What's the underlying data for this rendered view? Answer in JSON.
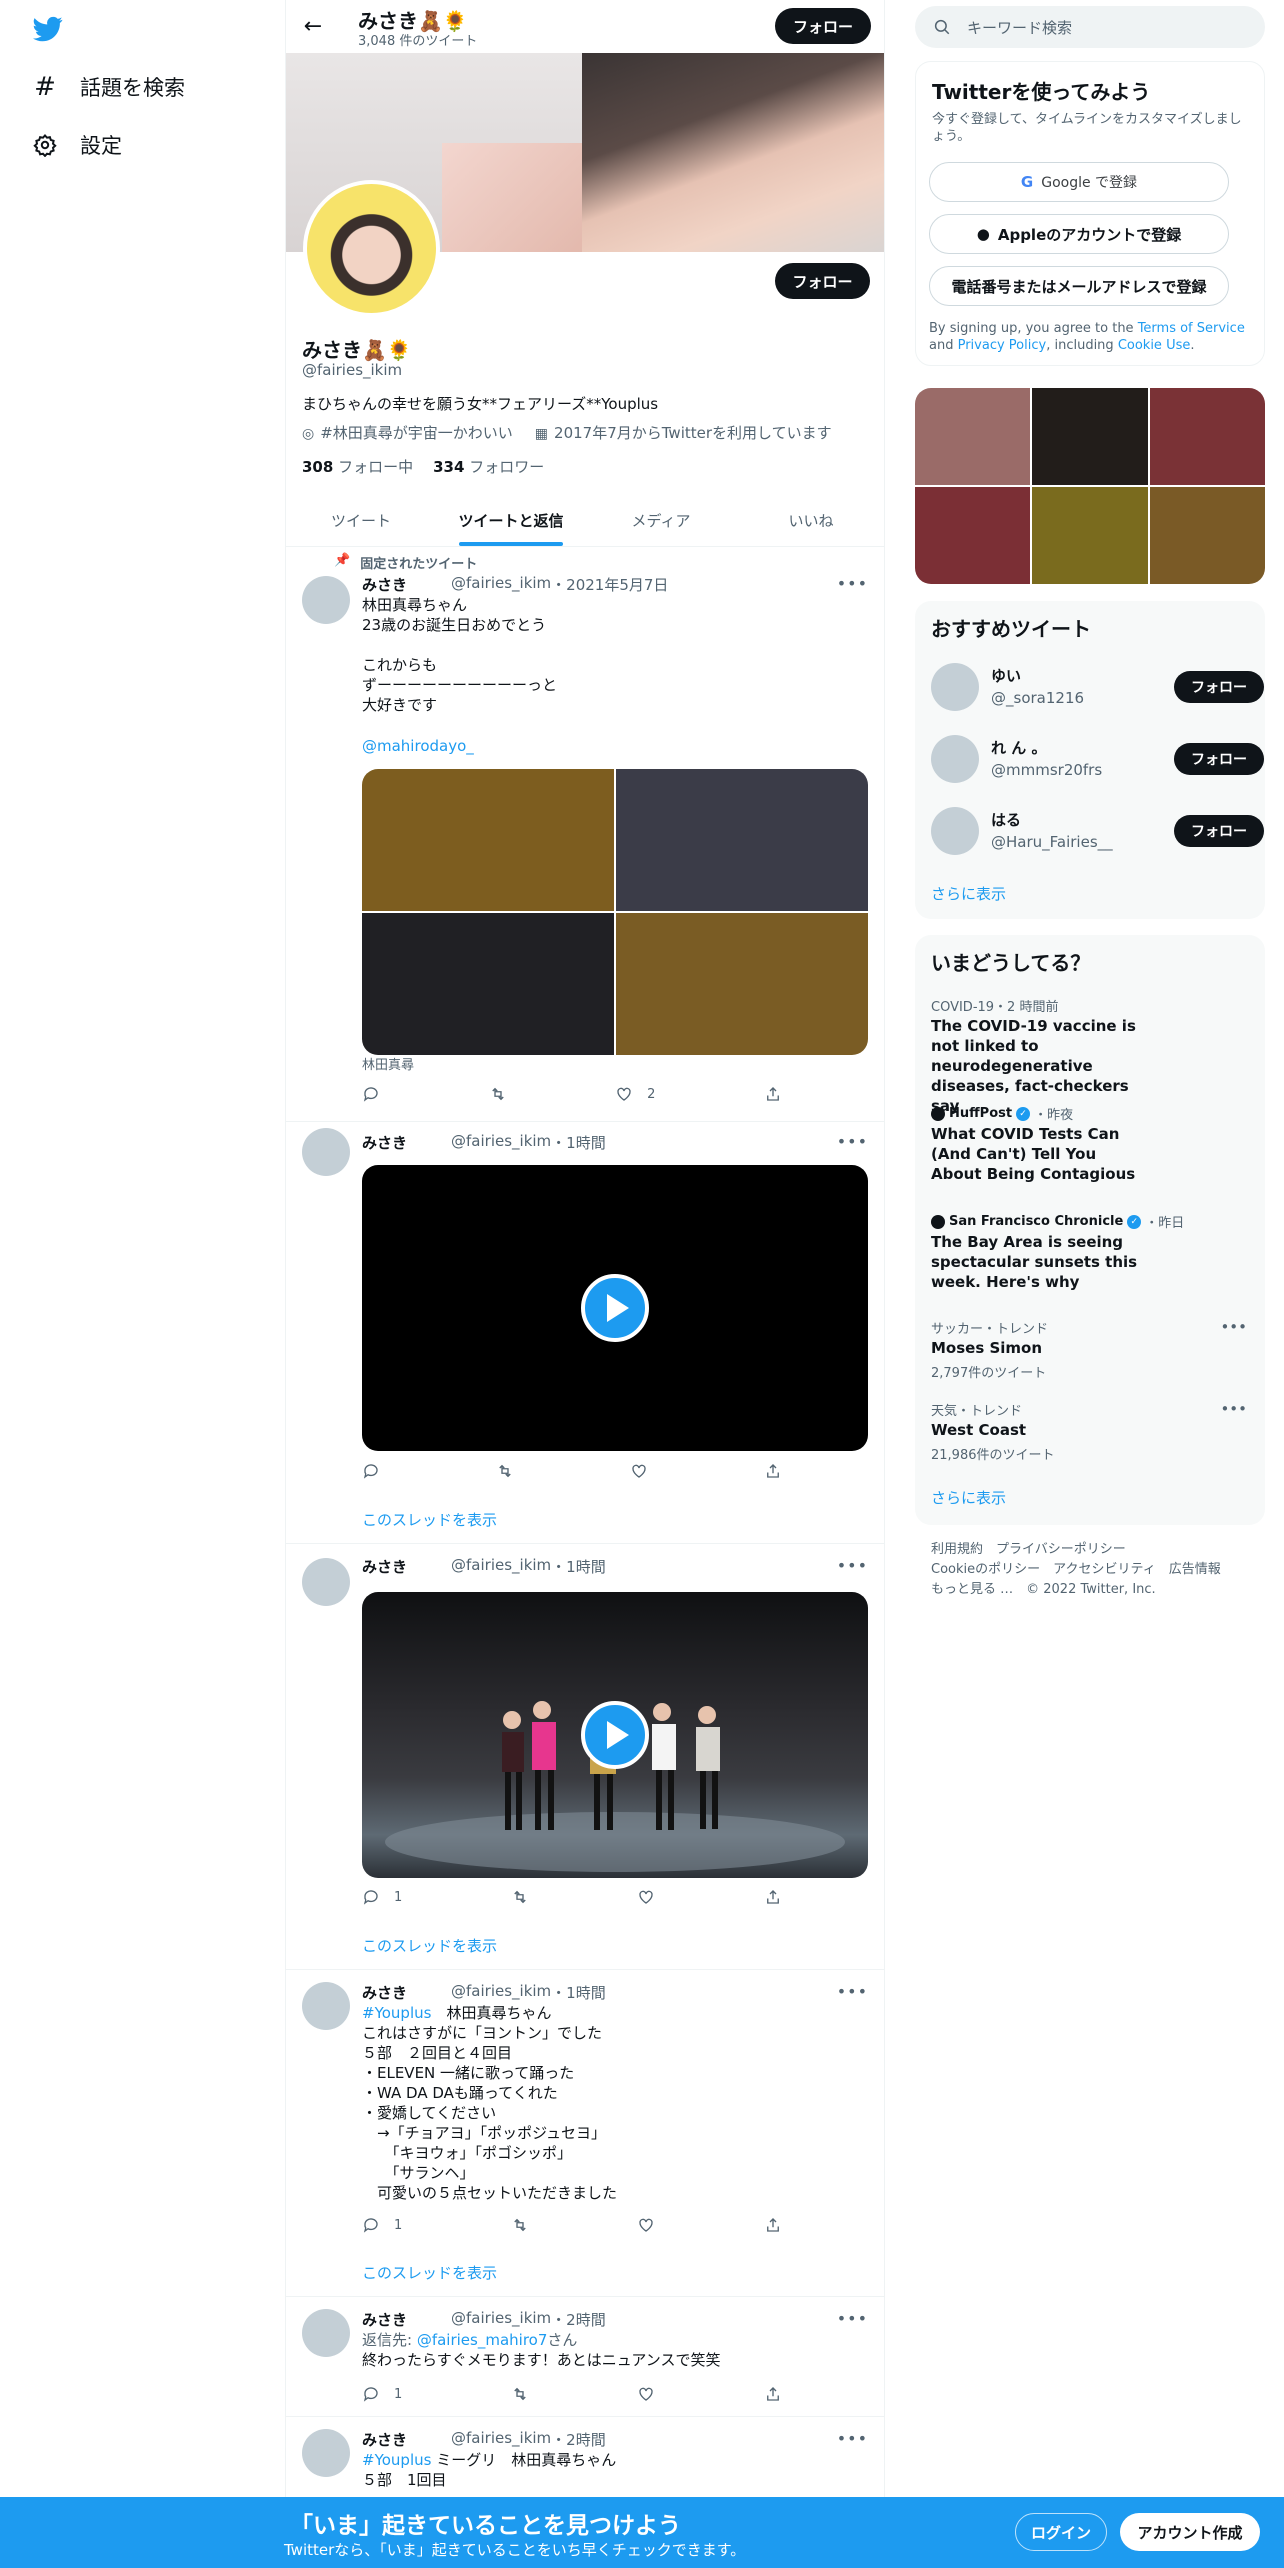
{
  "nav": {
    "explore_label": "話題を検索",
    "settings_label": "設定"
  },
  "header": {
    "name": "みさき🧸🌻",
    "tweet_count": "3,048 件のツイート",
    "follow_label": "フォロー"
  },
  "profile": {
    "name": "みさき🧸🌻",
    "handle": "@fairies_ikim",
    "bio": "まひちゃんの幸せを願う女**フェアリーズ**Youplus",
    "location": "#林田真尋が宇宙一かわいい",
    "joined": "2017年7月からTwitterを利用しています",
    "following_count": "308",
    "following_label": "フォロー中",
    "followers_count": "334",
    "followers_label": "フォロワー",
    "follow_label": "フォロー"
  },
  "tabs": [
    "ツイート",
    "ツイートと返信",
    "メディア",
    "いいね"
  ],
  "pinned_label": "固定されたツイート",
  "tweets": [
    {
      "name": "みさき",
      "handle": "@fairies_ikim",
      "time": "・2021年5月7日",
      "text": "林田真尋ちゃん\n23歳のお誕生日おめでとう\n\nこれからも\nずーーーーーーーーーーっと\n大好きです",
      "mention": "@mahirodayo_",
      "caption": "林田真尋",
      "likes": "2",
      "colors": [
        "#7d5d1f",
        "#3b3c48",
        "#202024",
        "#7a5c24"
      ]
    },
    {
      "name": "みさき",
      "handle": "@fairies_ikim",
      "time": "・1時間",
      "thread": "このスレッドを表示"
    },
    {
      "name": "みさき",
      "handle": "@fairies_ikim",
      "time": "・1時間",
      "replies": "1",
      "thread": "このスレッドを表示"
    },
    {
      "name": "みさき",
      "handle": "@fairies_ikim",
      "time": "・1時間",
      "hashtag": "#Youplus",
      "line1": "　林田真尋ちゃん",
      "text": "これはさすがに「ヨントン」でした\n５部　２回目と４回目\n・ELEVEN 一緒に歌って踊った\n・WA DA DAも踊ってくれた\n・愛嬌してください\n　→「チョアヨ」「ポッポジュセヨ」\n　　「キヨウォ」「ポゴシッポ」\n　　「サランヘ」\n　可愛いの５点セットいただきました",
      "replies": "1",
      "thread": "このスレッドを表示"
    },
    {
      "name": "みさき",
      "handle": "@fairies_ikim",
      "time": "・2時間",
      "reply_prefix": "返信先: ",
      "reply_to": "@fairies_mahiro7",
      "reply_suffix": "さん",
      "text": "終わったらすぐメモります！あとはニュアンスで笑笑",
      "replies": "1"
    },
    {
      "name": "みさき",
      "handle": "@fairies_ikim",
      "time": "・2時間",
      "hashtag": "#Youplus",
      "line1": " ミーグリ　林田真尋ちゃん",
      "text": "５部　1回目"
    }
  ],
  "right": {
    "search_placeholder": "キーワード検索",
    "signup": {
      "title": "Twitterを使ってみよう",
      "subtitle": "今すぐ登録して、タイムラインをカスタマイズしましょう。",
      "google": "Google で登録",
      "apple": "Appleのアカウントで登録",
      "phone": "電話番号またはメールアドレスで登録",
      "legal_1": "By signing up, you agree to the ",
      "terms": "Terms of Service",
      "legal_2": " and ",
      "privacy": "Privacy Policy",
      "legal_3": ", including ",
      "cookie": "Cookie Use",
      "legal_4": "."
    },
    "photo_colors": [
      "#9a6b68",
      "#221d1a",
      "#7a3236",
      "#7b2f35",
      "#7a6b1e",
      "#7a5a26"
    ],
    "recommend": {
      "title": "おすすめツイート",
      "users": [
        {
          "name": "ゆい",
          "handle": "@_sora1216"
        },
        {
          "name": "れ ん 。",
          "handle": "@mmmsr20frs"
        },
        {
          "name": "はる",
          "handle": "@Haru_Fairies__"
        }
      ],
      "follow_label": "フォロー",
      "more": "さらに表示"
    },
    "trends": {
      "title": "いまどうしてる？",
      "items": [
        {
          "meta": "COVID-19・2 時間前",
          "title": "The COVID-19 vaccine is not linked to neurodegenerative diseases, fact-checkers say"
        },
        {
          "source": "HuffPost",
          "when": "・昨夜",
          "title": "What COVID Tests Can (And Can't) Tell You About Being Contagious"
        },
        {
          "source": "San Francisco Chronicle",
          "when": "・昨日",
          "title": "The Bay Area is seeing spectacular sunsets this week. Here's why"
        },
        {
          "meta": "サッカー・トレンド",
          "title": "Moses Simon",
          "sub": "2,797件のツイート"
        },
        {
          "meta": "天気・トレンド",
          "title": "West Coast",
          "sub": "21,986件のツイート"
        }
      ],
      "more": "さらに表示"
    },
    "footer": {
      "line1": "利用規約　プライバシーポリシー",
      "line2": "Cookieのポリシー　アクセシビリティ　広告情報",
      "line3": "もっと見る …　© 2022 Twitter, Inc."
    }
  },
  "bottom": {
    "title": "「いま」起きていることを見つけよう",
    "subtitle": "Twitterなら、「いま」起きていることをいち早くチェックできます。",
    "login": "ログイン",
    "signup": "アカウント作成"
  }
}
